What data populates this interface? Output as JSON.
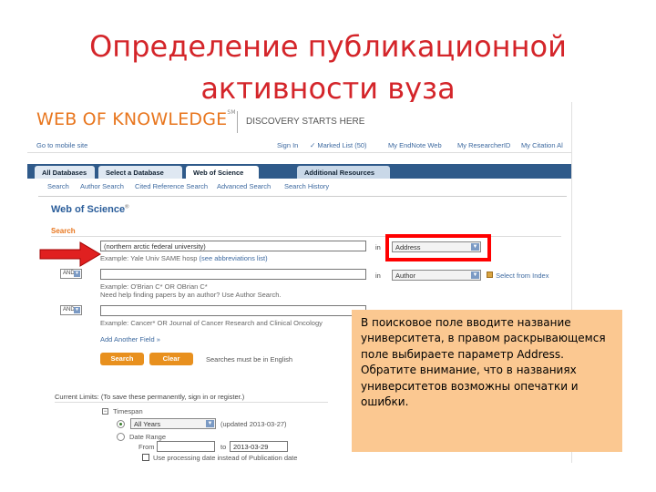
{
  "slide": {
    "title": "Определение публикационной активности вуза"
  },
  "header": {
    "logo": "WEB OF KNOWLEDGE",
    "logo_mark": "SM",
    "tagline": "DISCOVERY STARTS HERE"
  },
  "util": {
    "left": "Go to mobile site",
    "sign_in": "Sign In",
    "marked_list": "✓ Marked List (50)",
    "endnote": "My EndNote Web",
    "researcherid": "My ResearcherID",
    "citation_alerts": "My Citation Al"
  },
  "tabs": [
    {
      "label": "All Databases"
    },
    {
      "label": "Select a Database"
    },
    {
      "label": "Web of Science"
    },
    {
      "label": "Additional Resources"
    }
  ],
  "subtabs": [
    {
      "label": "Search"
    },
    {
      "label": "Author Search"
    },
    {
      "label": "Cited Reference Search"
    },
    {
      "label": "Advanced Search"
    },
    {
      "label": "Search History"
    }
  ],
  "page": {
    "title": "Web of Science",
    "title_mark": "®",
    "search_label": "Search"
  },
  "form": {
    "row1": {
      "value": "(northern arctic federal university)",
      "example": "Example: Yale Univ SAME hosp",
      "example_link": "(see abbreviations list)",
      "in": "in",
      "field": "Address"
    },
    "row2": {
      "operator": "AND",
      "example_line1": "Example: O'Brian C* OR OBrian C*",
      "example_line2": "Need help finding papers by an author? Use Author Search.",
      "in": "in",
      "field": "Author",
      "select_index": "Select from Index"
    },
    "row3": {
      "operator": "AND",
      "example": "Example: Cancer* OR Journal of Cancer Research and Clinical Oncology"
    },
    "add_field": "Add Another Field »",
    "search_button": "Search",
    "clear_button": "Clear",
    "english_note": "Searches must be in English"
  },
  "limits": {
    "title": "Current Limits: (To save these permanently, sign in or register.)",
    "timespan_label": "Timespan",
    "all_years": "All Years",
    "updated": "(updated 2013-03-27)",
    "date_range": "Date Range",
    "from_label": "From",
    "to_label": "to",
    "to_value": "2013-03-29",
    "use_processing": "Use processing date instead of Publication date"
  },
  "callout": {
    "text": "В поисковое поле вводите название университета,  в правом раскрывающемся поле выбираете параметр Address. Обратите внимание, что в названиях университетов возможны опечатки и ошибки."
  },
  "colors": {
    "title_red": "#d4252a",
    "logo_orange": "#e8761e",
    "highlight_red": "#ff0000",
    "callout_bg": "#fbc891",
    "tab_bar": "#2f5a8a"
  }
}
